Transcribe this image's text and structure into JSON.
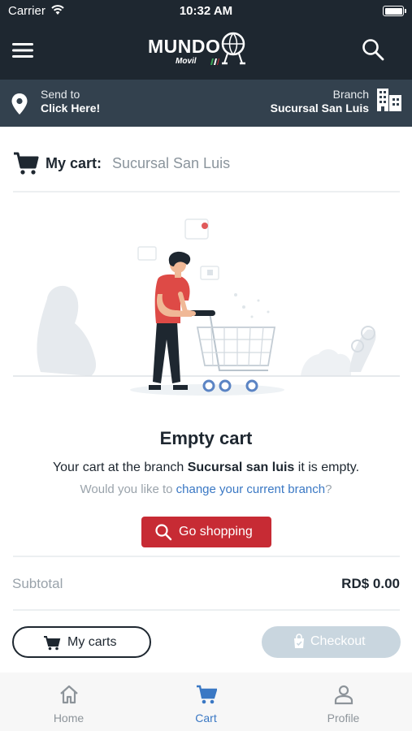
{
  "status_bar": {
    "carrier": "Carrier",
    "time": "10:32 AM"
  },
  "header": {
    "logo_text": "MUNDO",
    "logo_subtext": "Movil"
  },
  "location": {
    "send_label": "Send to",
    "send_value": "Click Here!",
    "branch_label": "Branch",
    "branch_value": "Sucursal San Luis"
  },
  "cart": {
    "title": "My cart:",
    "branch": "Sucursal San Luis",
    "empty_title": "Empty cart",
    "message_prefix": "Your cart at the branch",
    "message_branch": "Sucursal san luis",
    "message_suffix": "it is empty.",
    "question_prefix": "Would you like to",
    "question_link": "change your current branch",
    "question_suffix": "?",
    "go_shopping_label": "Go shopping"
  },
  "summary": {
    "subtotal_label": "Subtotal",
    "subtotal_value": "RD$ 0.00"
  },
  "actions": {
    "my_carts_label": "My carts",
    "checkout_label": "Checkout"
  },
  "tabs": [
    {
      "label": "Home",
      "icon": "home-icon",
      "active": false
    },
    {
      "label": "Cart",
      "icon": "cart-icon",
      "active": true
    },
    {
      "label": "Profile",
      "icon": "profile-icon",
      "active": false
    }
  ],
  "colors": {
    "header_bg": "#1e2730",
    "location_bg": "#33414e",
    "primary_red": "#c72b34",
    "link_blue": "#3a78c4",
    "checkout_disabled": "#c9d6df"
  }
}
